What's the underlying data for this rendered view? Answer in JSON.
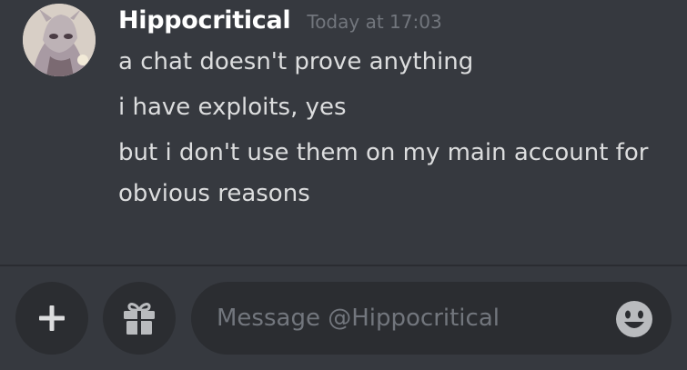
{
  "message": {
    "author": "Hippocritical",
    "timestamp": "Today at 17:03",
    "lines": [
      "a chat doesn't prove anything",
      "i have exploits, yes",
      "but i don't use them on my main account for obvious reasons"
    ]
  },
  "composer": {
    "placeholder": "Message @Hippocritical",
    "add_icon": "plus-icon",
    "gift_icon": "gift-icon",
    "emoji_icon": "emoji-icon"
  },
  "colors": {
    "background": "#36393f",
    "username": "#ffffff",
    "message_text": "#dcddde",
    "muted_text": "#72767d",
    "button_bg": "#2b2d31"
  }
}
